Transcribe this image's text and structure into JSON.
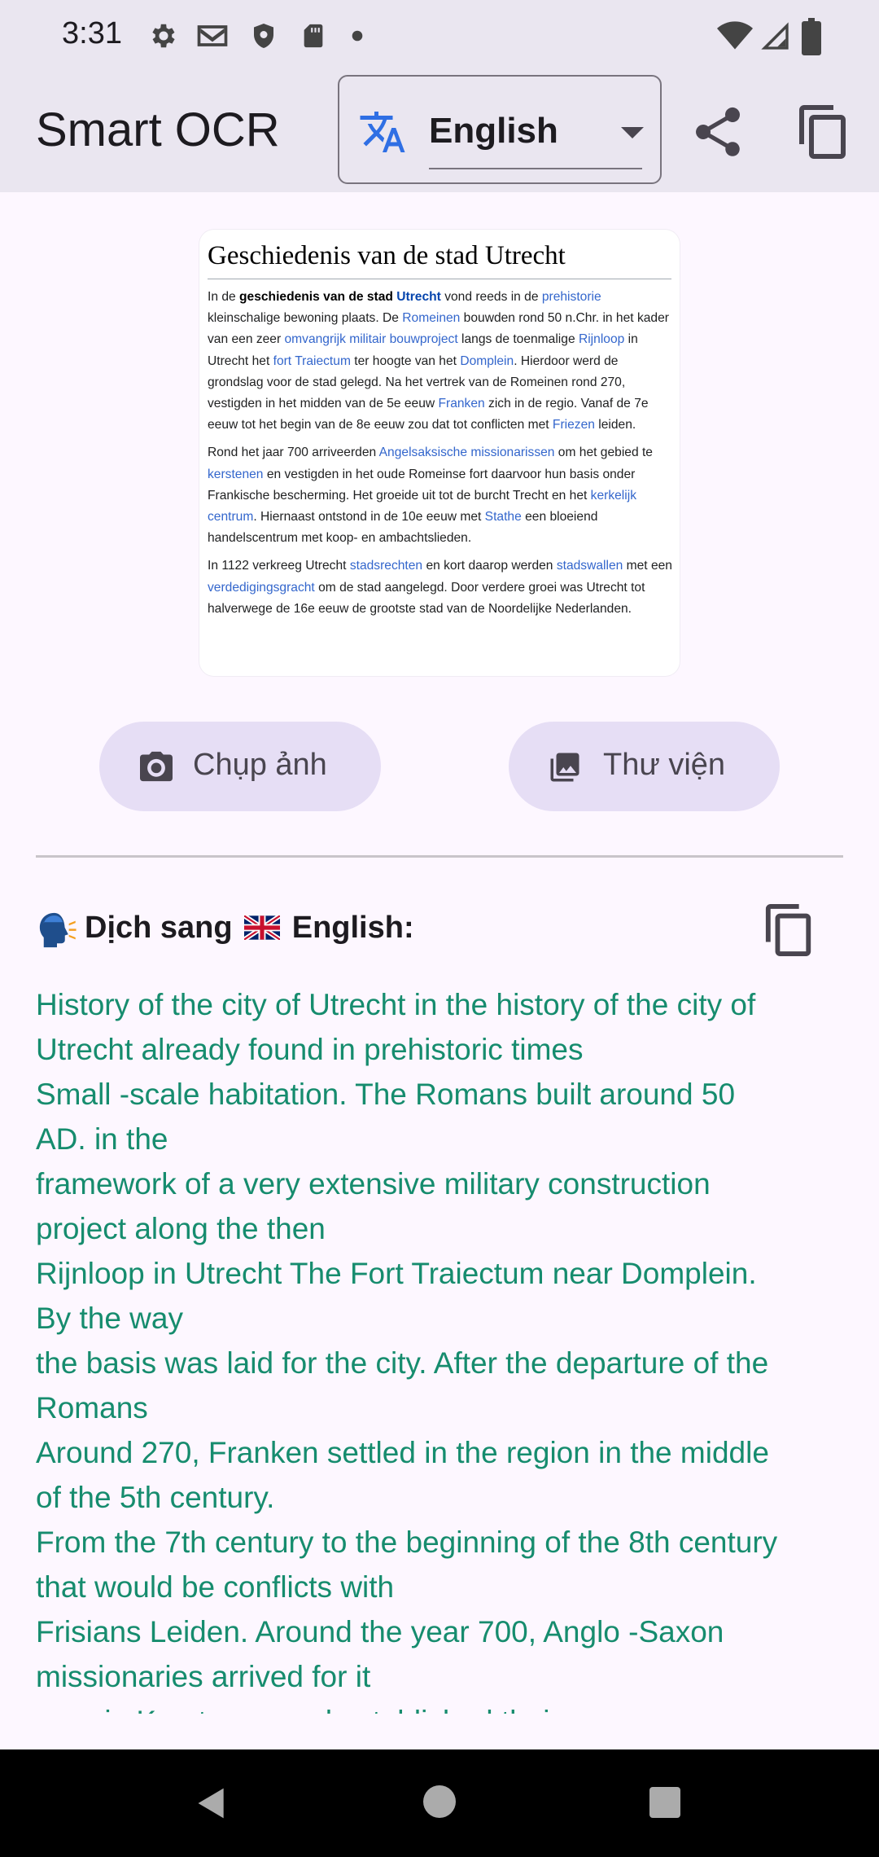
{
  "status_bar": {
    "time": "3:31",
    "left_icons": [
      "settings-icon",
      "gmail-icon",
      "shield-icon",
      "sd-card-icon",
      "dot-icon"
    ],
    "right_icons": [
      "wifi-icon",
      "signal-icon",
      "battery-icon"
    ]
  },
  "app_bar": {
    "title": "Smart OCR",
    "language_select": {
      "icon": "translate-icon",
      "value": "English"
    },
    "actions": [
      "share-icon",
      "copy-icon"
    ]
  },
  "source_image": {
    "title": "Geschiedenis van de stad Utrecht",
    "paragraphs": [
      "In de geschiedenis van de stad Utrecht vond reeds in de prehistorie kleinschalige bewoning plaats. De Romeinen bouwden rond 50 n.Chr. in het kader van een zeer omvangrijk militair bouwproject langs de toenmalige Rijnloop in Utrecht het fort Traiectum ter hoogte van het Domplein. Hierdoor werd de grondslag voor de stad gelegd. Na het vertrek van de Romeinen rond 270, vestigden in het midden van de 5e eeuw Franken zich in de regio. Vanaf de 7e eeuw tot het begin van de 8e eeuw zou dat tot conflicten met Friezen leiden.",
      "Rond het jaar 700 arriveerden Angelsaksische missionarissen om het gebied te kerstenen en vestigden in het oude Romeinse fort daarvoor hun basis onder Frankische bescherming. Het groeide uit tot de burcht Trecht en het kerkelijk centrum. Hiernaast ontstond in de 10e eeuw met Stathe een bloeiend handelscentrum met koop- en ambachtslieden.",
      "In 1122 verkreeg Utrecht stadsrechten en kort daarop werden stadswallen met een verdedigingsgracht om de stad aangelegd. Door verdere groei was Utrecht tot halverwege de 16e eeuw de grootste stad van de Noordelijke Nederlanden."
    ],
    "accent_link_color": "#3366cc"
  },
  "buttons": {
    "camera": {
      "icon": "camera-icon",
      "label": "Chụp ảnh"
    },
    "gallery": {
      "icon": "image-icon",
      "label": "Thư viện"
    }
  },
  "translation": {
    "header_prefix": "Dịch sang",
    "header_language": "English:",
    "flag": "uk-flag-icon",
    "speak_icon": "speaking-head-icon",
    "lines": [
      "History of the city of Utrecht in the history of the city of",
      "Utrecht already found in prehistoric times",
      "Small -scale habitation. The Romans built around 50",
      "AD. in the",
      "framework of a very extensive military construction",
      "project along the then",
      "Rijnloop in Utrecht The Fort Traiectum near Domplein.",
      "By the way",
      "the basis was laid for the city. After the departure of the",
      "Romans",
      "Around 270, Franken settled in the region in the middle",
      "of the 5th century.",
      "From the 7th century to the beginning of the 8th century",
      "that would be conflicts with",
      "Frisians Leiden. Around the year 700, Anglo -Saxon",
      "missionaries arrived for it",
      "area in Kerstenen and established their"
    ],
    "text_color": "#168c6e"
  },
  "colors": {
    "app_bar_bg": "#eae6f0",
    "background": "#fdf7ff",
    "button_bg": "#e6def5",
    "translate_icon": "#2f6fe4"
  }
}
